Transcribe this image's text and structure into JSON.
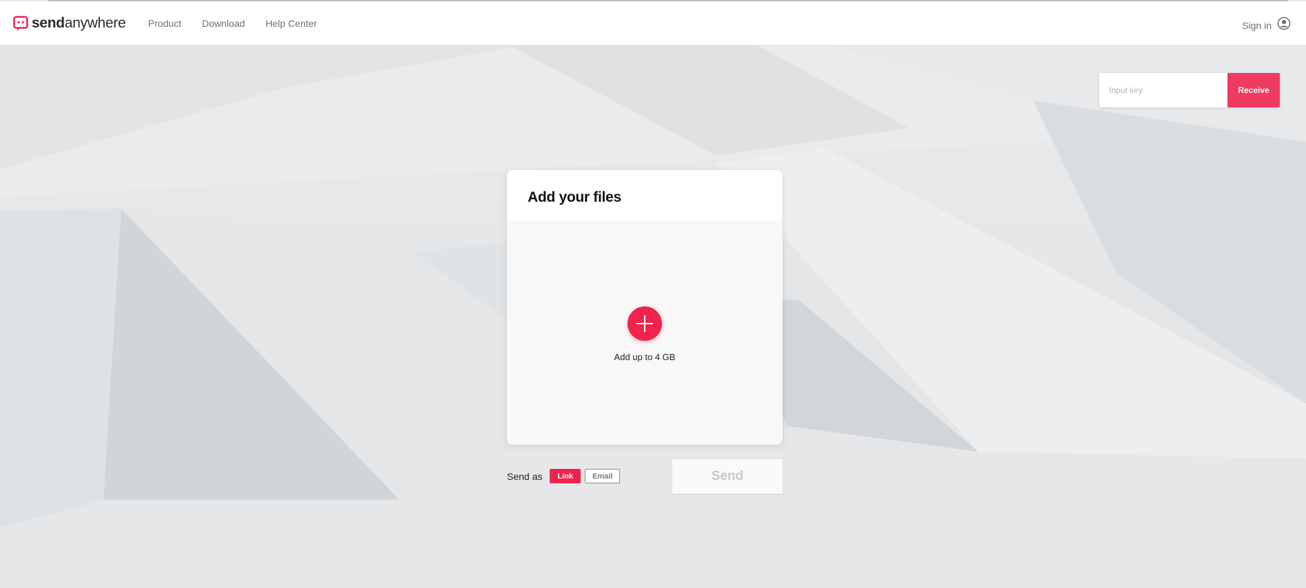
{
  "brand": {
    "name_bold": "send",
    "name_light": "anywhere",
    "logo_icon": "sendanywhere-logo-icon",
    "accent_color": "#f0234f"
  },
  "nav": {
    "items": [
      {
        "label": "Product"
      },
      {
        "label": "Download"
      },
      {
        "label": "Help Center"
      }
    ]
  },
  "account": {
    "signin_label": "Sign in",
    "icon": "user-circle-icon"
  },
  "receive": {
    "placeholder": "Input key",
    "button_label": "Receive"
  },
  "upload_card": {
    "title": "Add your files",
    "add_icon": "plus-icon",
    "limit_text": "Add up to 4 GB"
  },
  "send_options": {
    "label": "Send as",
    "options": [
      {
        "label": "Link",
        "selected": true
      },
      {
        "label": "Email",
        "selected": false
      }
    ],
    "send_button_label": "Send"
  }
}
